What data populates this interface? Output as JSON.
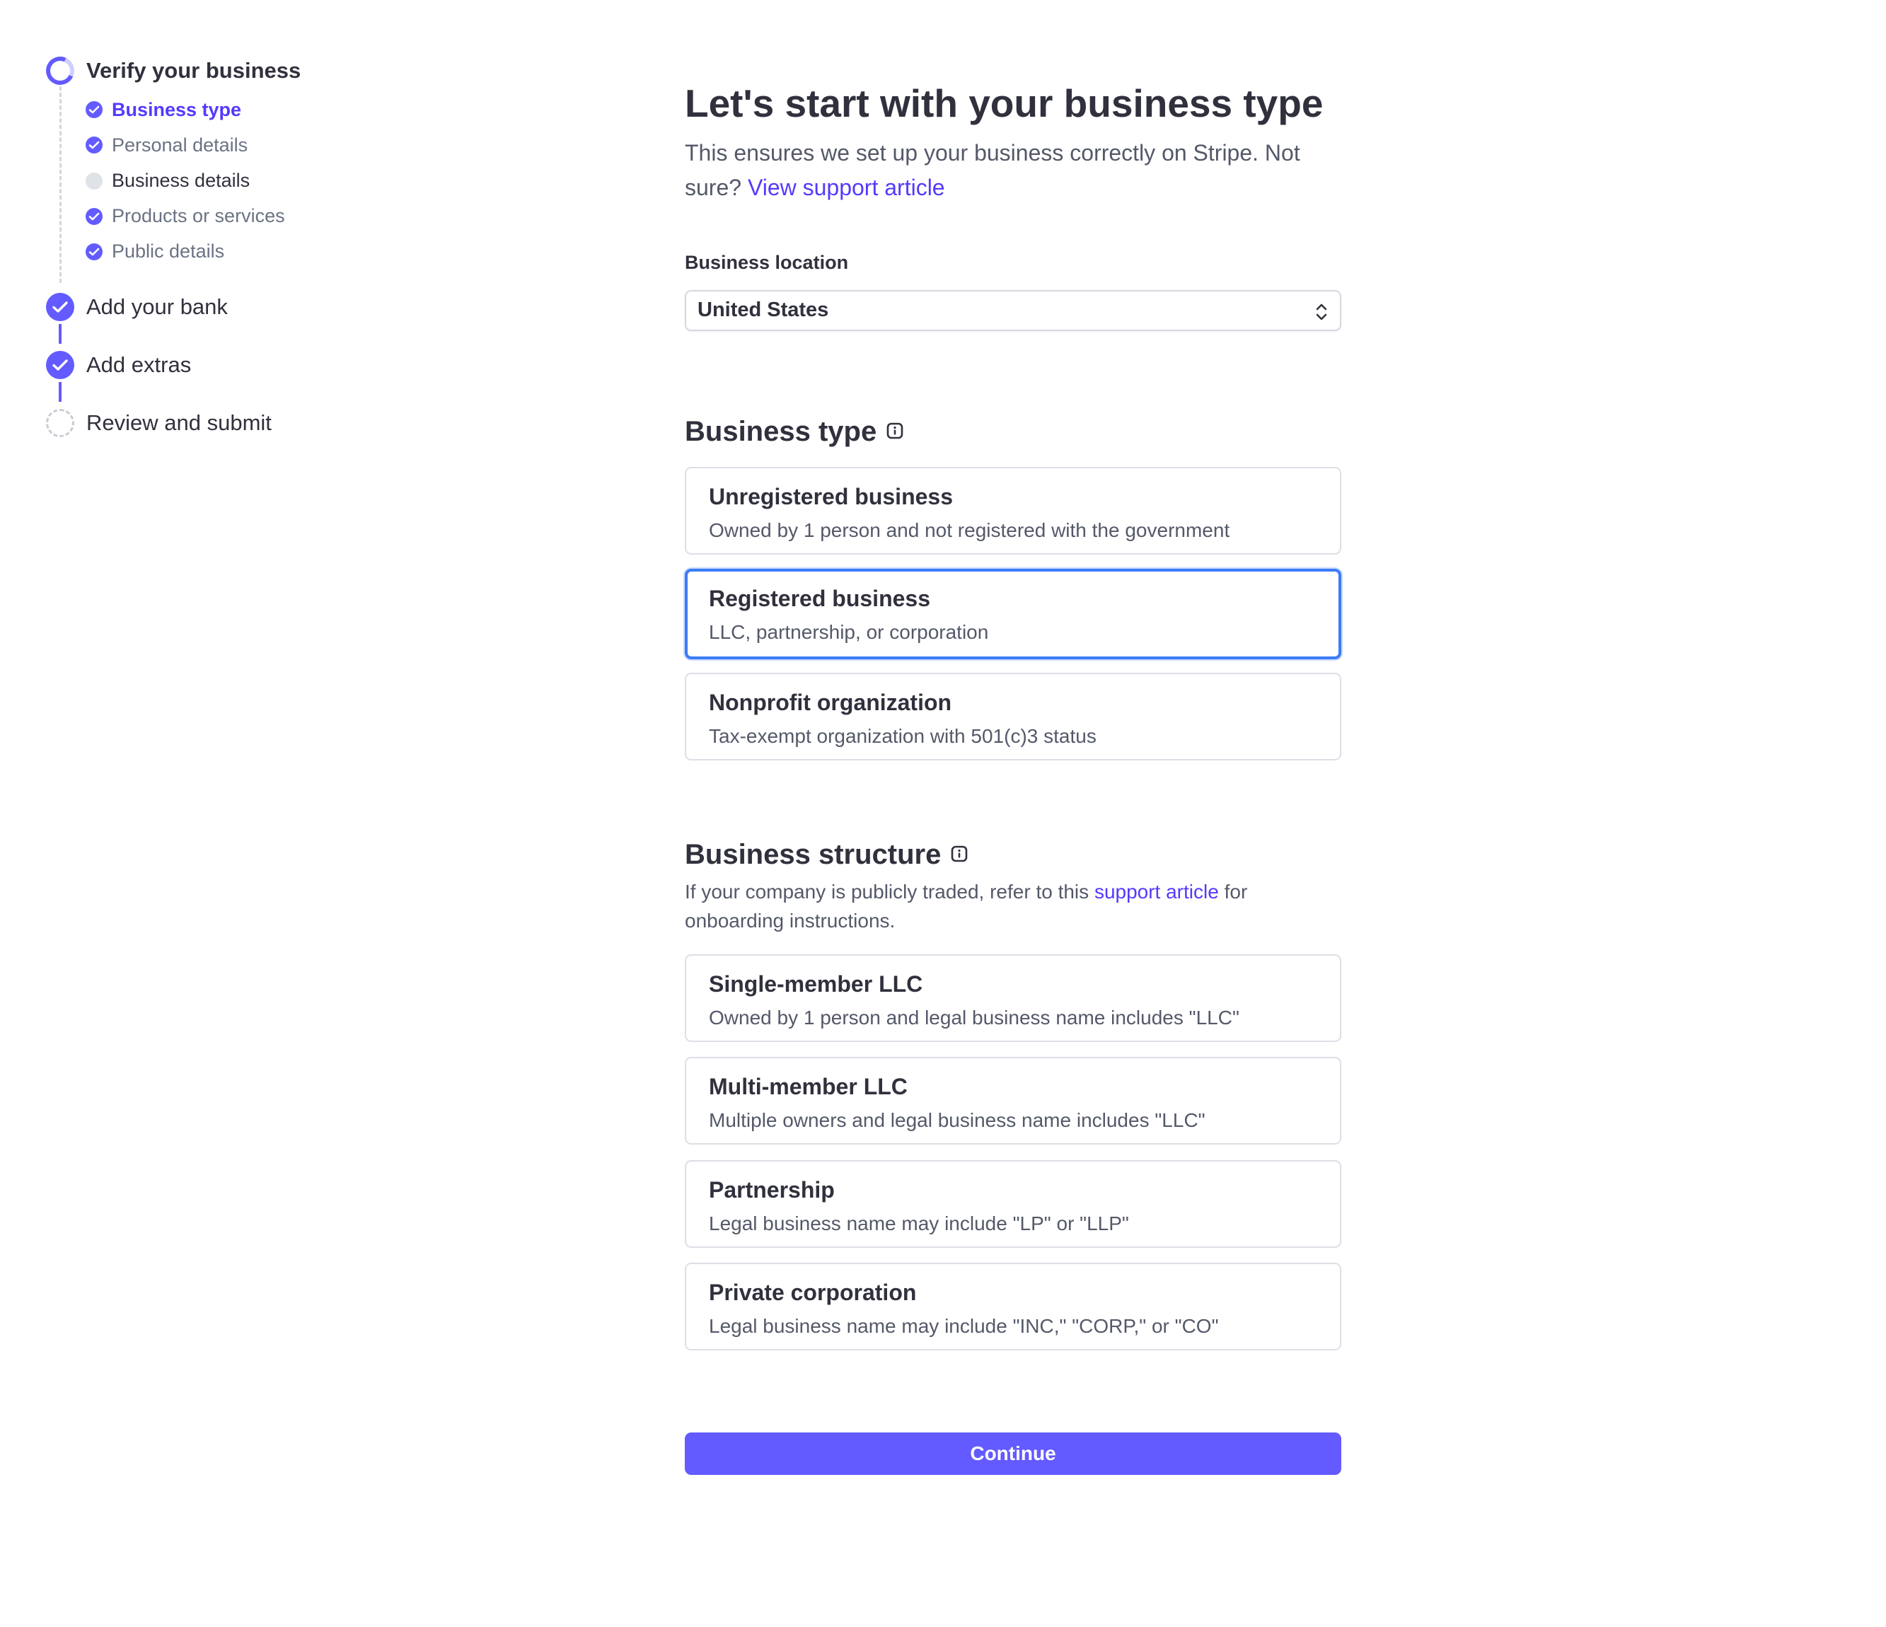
{
  "sidebar": {
    "steps": [
      {
        "label": "Verify your business",
        "state": "in-progress"
      },
      {
        "label": "Add your bank",
        "state": "complete"
      },
      {
        "label": "Add extras",
        "state": "complete"
      },
      {
        "label": "Review and submit",
        "state": "incomplete"
      }
    ],
    "substeps": [
      {
        "label": "Business type",
        "state": "active"
      },
      {
        "label": "Personal details",
        "state": "complete"
      },
      {
        "label": "Business details",
        "state": "incomplete"
      },
      {
        "label": "Products or services",
        "state": "complete"
      },
      {
        "label": "Public details",
        "state": "complete"
      }
    ]
  },
  "main": {
    "title": "Let's start with your business type",
    "subtitle_text": "This ensures we set up your business correctly on Stripe. Not sure?",
    "subtitle_link": "View support article",
    "location": {
      "label": "Business location",
      "value": "United States"
    },
    "business_type": {
      "heading": "Business type",
      "options": [
        {
          "title": "Unregistered business",
          "desc": "Owned by 1 person and not registered with the government"
        },
        {
          "title": "Registered business",
          "desc": "LLC, partnership, or corporation",
          "selected": true
        },
        {
          "title": "Nonprofit organization",
          "desc": "Tax-exempt organization with 501(c)3 status"
        }
      ]
    },
    "business_structure": {
      "heading": "Business structure",
      "desc_before": "If your company is publicly traded, refer to this",
      "desc_link": "support article",
      "desc_after": "for onboarding instructions.",
      "options": [
        {
          "title": "Single-member LLC",
          "desc": "Owned by 1 person and legal business name includes \"LLC\""
        },
        {
          "title": "Multi-member LLC",
          "desc": "Multiple owners and legal business name includes \"LLC\""
        },
        {
          "title": "Partnership",
          "desc": "Legal business name may include \"LP\" or \"LLP\""
        },
        {
          "title": "Private corporation",
          "desc": "Legal business name may include \"INC,\" \"CORP,\" or \"CO\""
        }
      ]
    },
    "continue_label": "Continue"
  },
  "colors": {
    "accent": "#635bff",
    "link": "#533afd",
    "selected_border": "#3b7cf6"
  }
}
